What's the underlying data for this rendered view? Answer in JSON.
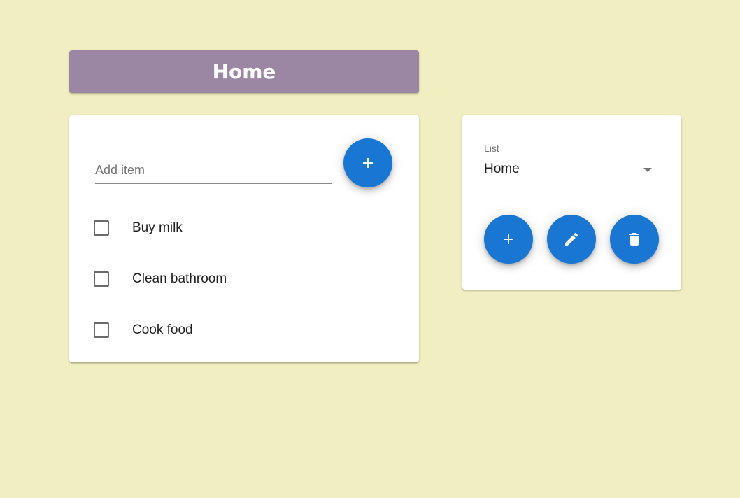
{
  "header": {
    "title": "Home"
  },
  "todo": {
    "add_placeholder": "Add item",
    "add_value": "",
    "items": [
      {
        "label": "Buy milk",
        "checked": false
      },
      {
        "label": "Clean bathroom",
        "checked": false
      },
      {
        "label": "Cook food",
        "checked": false
      }
    ]
  },
  "list_panel": {
    "select_label": "List",
    "selected_value": "Home",
    "actions": [
      "add-icon",
      "edit-icon",
      "delete-icon"
    ]
  },
  "colors": {
    "background": "#f1efc1",
    "header": "#9b86a3",
    "accent": "#1976d2"
  }
}
